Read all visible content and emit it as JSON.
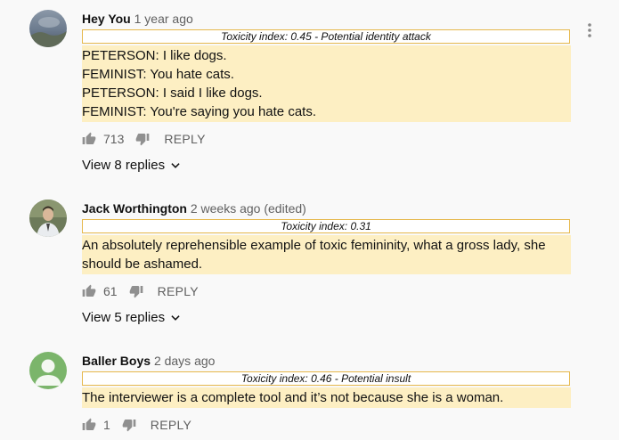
{
  "comments": [
    {
      "author": "Hey You",
      "time": "1 year ago",
      "toxicity": "Toxicity index: 0.45 - Potential identity attack",
      "lines": [
        "PETERSON: I like dogs.",
        "FEMINIST: You hate cats.",
        "PETERSON: I said I like dogs.",
        "FEMINIST: You're saying you hate cats."
      ],
      "likes": "713",
      "reply_label": "REPLY",
      "view_replies": "View 8 replies"
    },
    {
      "author": "Jack Worthington",
      "time": "2 weeks ago (edited)",
      "toxicity": "Toxicity index: 0.31",
      "lines": [
        "An absolutely reprehensible example of toxic femininity, what a gross lady, she",
        "should be ashamed."
      ],
      "likes": "61",
      "reply_label": "REPLY",
      "view_replies": "View 5 replies"
    },
    {
      "author": "Baller Boys",
      "time": "2 days ago",
      "toxicity": "Toxicity index: 0.46 - Potential insult",
      "lines": [
        "The interviewer is a complete tool and it’s not because she is a woman."
      ],
      "likes": "1",
      "reply_label": "REPLY"
    }
  ],
  "icons": {
    "like": "thumbs-up-icon",
    "dislike": "thumbs-down-icon",
    "expand": "chevron-down-icon",
    "more": "more-vert-icon"
  },
  "colors": {
    "highlight": "#fdefc3",
    "toxicity_border": "#e6b84c",
    "avatar_green": "#7bb56b"
  }
}
